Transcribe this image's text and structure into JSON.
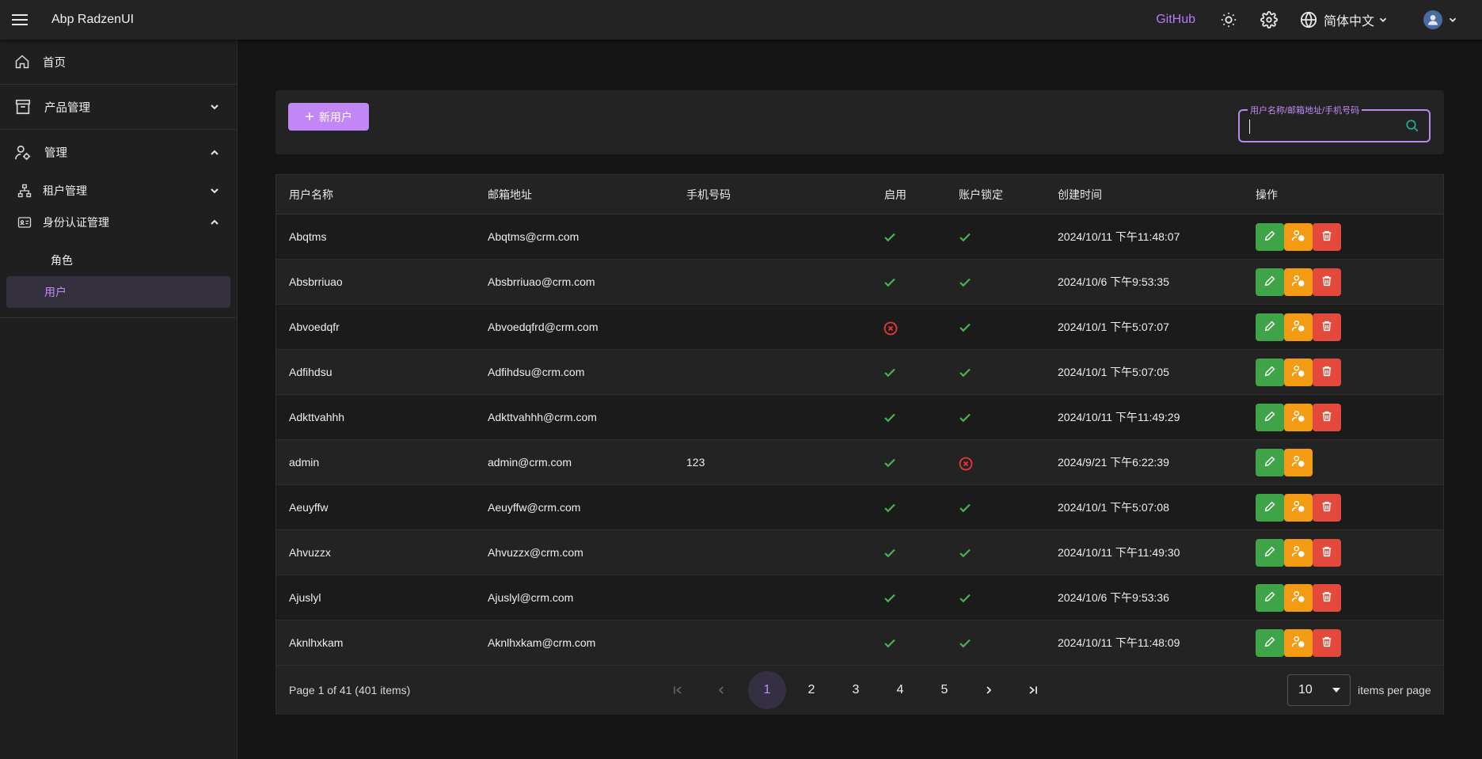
{
  "header": {
    "title": "Abp RadzenUI",
    "github": "GitHub",
    "language": "简体中文"
  },
  "sidebar": {
    "home": "首页",
    "product": "产品管理",
    "admin": "管理",
    "tenant": "租户管理",
    "identity": "身份认证管理",
    "roles": "角色",
    "users": "用户"
  },
  "toolbar": {
    "new_user": "新用户",
    "search_label": "用户名称/邮箱地址/手机号码",
    "search_value": ""
  },
  "table": {
    "columns": [
      "用户名称",
      "邮箱地址",
      "手机号码",
      "启用",
      "账户锁定",
      "创建时间",
      "操作"
    ],
    "rows": [
      {
        "name": "Abqtms",
        "email": "Abqtms@crm.com",
        "phone": "",
        "enabled": true,
        "locked_check": true,
        "created": "2024/10/11 下午11:48:07",
        "deletable": true
      },
      {
        "name": "Absbrriuao",
        "email": "Absbrriuao@crm.com",
        "phone": "",
        "enabled": true,
        "locked_check": true,
        "created": "2024/10/6 下午9:53:35",
        "deletable": true
      },
      {
        "name": "Abvoedqfr",
        "email": "Abvoedqfrd@crm.com",
        "phone": "",
        "enabled": false,
        "locked_check": true,
        "created": "2024/10/1 下午5:07:07",
        "deletable": true
      },
      {
        "name": "Adfihdsu",
        "email": "Adfihdsu@crm.com",
        "phone": "",
        "enabled": true,
        "locked_check": true,
        "created": "2024/10/1 下午5:07:05",
        "deletable": true
      },
      {
        "name": "Adkttvahhh",
        "email": "Adkttvahhh@crm.com",
        "phone": "",
        "enabled": true,
        "locked_check": true,
        "created": "2024/10/11 下午11:49:29",
        "deletable": true
      },
      {
        "name": "admin",
        "email": "admin@crm.com",
        "phone": "123",
        "enabled": true,
        "locked_check": false,
        "created": "2024/9/21 下午6:22:39",
        "deletable": false
      },
      {
        "name": "Aeuyffw",
        "email": "Aeuyffw@crm.com",
        "phone": "",
        "enabled": true,
        "locked_check": true,
        "created": "2024/10/1 下午5:07:08",
        "deletable": true
      },
      {
        "name": "Ahvuzzx",
        "email": "Ahvuzzx@crm.com",
        "phone": "",
        "enabled": true,
        "locked_check": true,
        "created": "2024/10/11 下午11:49:30",
        "deletable": true
      },
      {
        "name": "Ajuslyl",
        "email": "Ajuslyl@crm.com",
        "phone": "",
        "enabled": true,
        "locked_check": true,
        "created": "2024/10/6 下午9:53:36",
        "deletable": true
      },
      {
        "name": "Aknlhxkam",
        "email": "Aknlhxkam@crm.com",
        "phone": "",
        "enabled": true,
        "locked_check": true,
        "created": "2024/10/11 下午11:48:09",
        "deletable": true
      }
    ]
  },
  "pager": {
    "summary": "Page 1 of 41 (401 items)",
    "pages": [
      "1",
      "2",
      "3",
      "4",
      "5"
    ],
    "current": "1",
    "page_size": "10",
    "items_per_page": "items per page"
  },
  "colors": {
    "accent": "#c287f7",
    "check": "#4caf50",
    "cross": "#e53935",
    "edit": "#3fa447",
    "role": "#f39b12",
    "delete": "#e34a3b"
  },
  "icons": [
    "menu-icon",
    "sun-icon",
    "gear-icon",
    "globe-icon",
    "chevron-down-icon",
    "home-icon",
    "box-icon",
    "user-cog-icon",
    "sitemap-icon",
    "id-card-icon",
    "search-icon",
    "pencil-icon",
    "user-role-icon",
    "trash-icon",
    "check-icon",
    "cross-circle-icon",
    "first-page-icon",
    "prev-page-icon",
    "next-page-icon",
    "last-page-icon"
  ]
}
